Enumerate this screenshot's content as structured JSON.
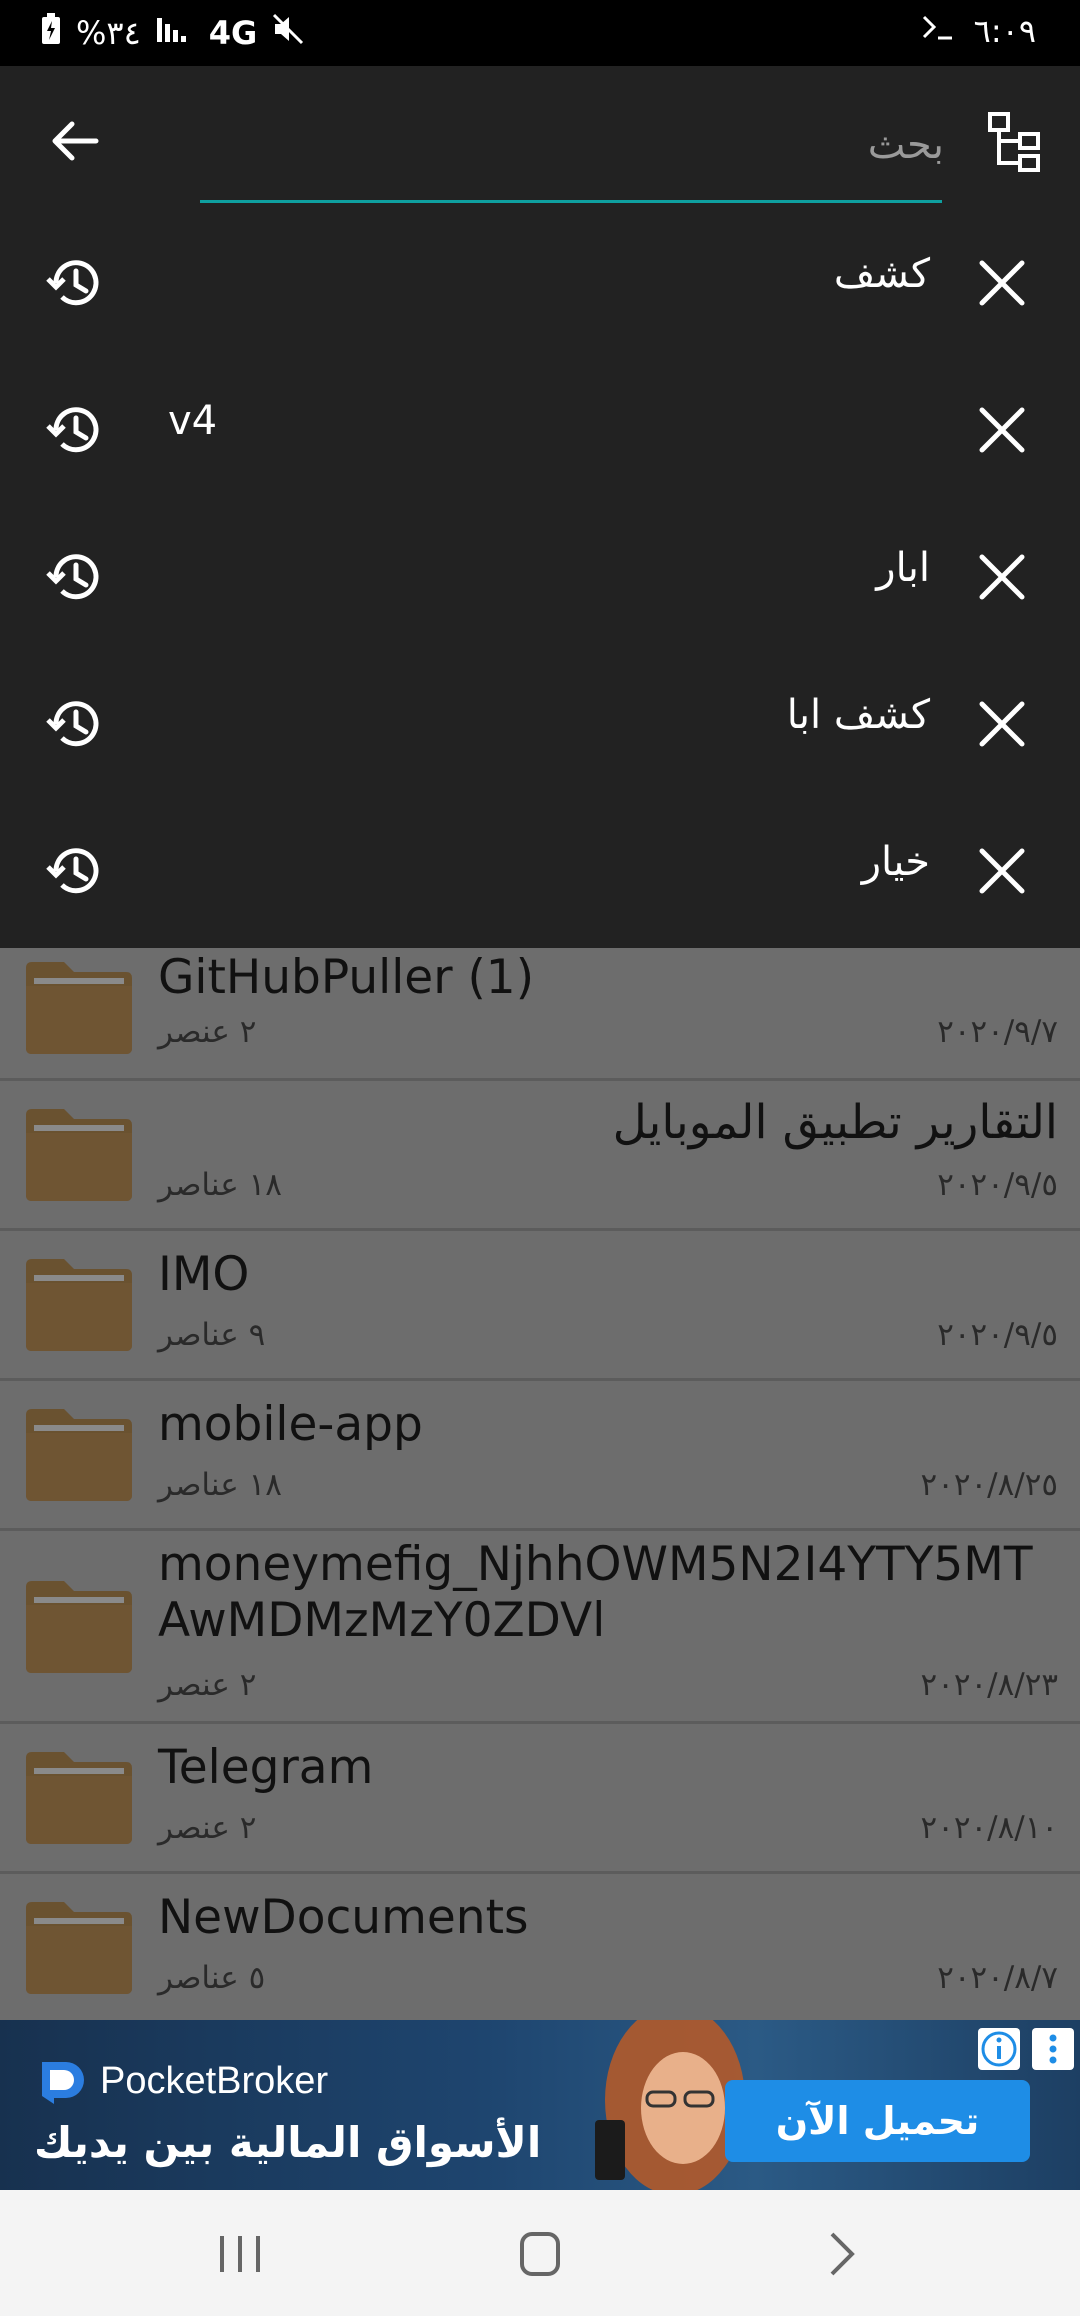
{
  "status_bar": {
    "battery": "%٣٤",
    "network": "4G",
    "time": "٦:٠٩"
  },
  "search": {
    "placeholder": "بحث",
    "value": ""
  },
  "history": [
    {
      "term": "كشف"
    },
    {
      "term": "v4"
    },
    {
      "term": "ابار"
    },
    {
      "term": "كشف ابا"
    },
    {
      "term": "خيار"
    }
  ],
  "files": [
    {
      "name": "GitHubPuller (1)",
      "count": "٢ عنصر",
      "date": "٢٠٢٠/٩/٧"
    },
    {
      "name": "التقارير تطبيق الموبايل",
      "count": "١٨ عناصر",
      "date": "٢٠٢٠/٩/٥"
    },
    {
      "name": "IMO",
      "count": "٩ عناصر",
      "date": "٢٠٢٠/٩/٥"
    },
    {
      "name": "mobile-app",
      "count": "١٨ عناصر",
      "date": "٢٠٢٠/٨/٢٥"
    },
    {
      "name": "moneymefig_NjhhOWM5N2I4YTY5MTAwMDMzMzY0ZDVl",
      "count": "٢ عنصر",
      "date": "٢٠٢٠/٨/٢٣"
    },
    {
      "name": "Telegram",
      "count": "٢ عنصر",
      "date": "٢٠٢٠/٨/١٠"
    },
    {
      "name": "NewDocuments",
      "count": "٥ عناصر",
      "date": "٢٠٢٠/٨/٧"
    }
  ],
  "ad": {
    "brand": "PocketBroker",
    "tagline": "الأسواق المالية بين يديك",
    "cta": "تحميل الآن"
  },
  "colors": {
    "panel": "#222222",
    "accent_underline": "#0fa0a0",
    "list_bg": "#6d6d6d",
    "folder": "#6a5230",
    "ad_button": "#1e8de6"
  }
}
